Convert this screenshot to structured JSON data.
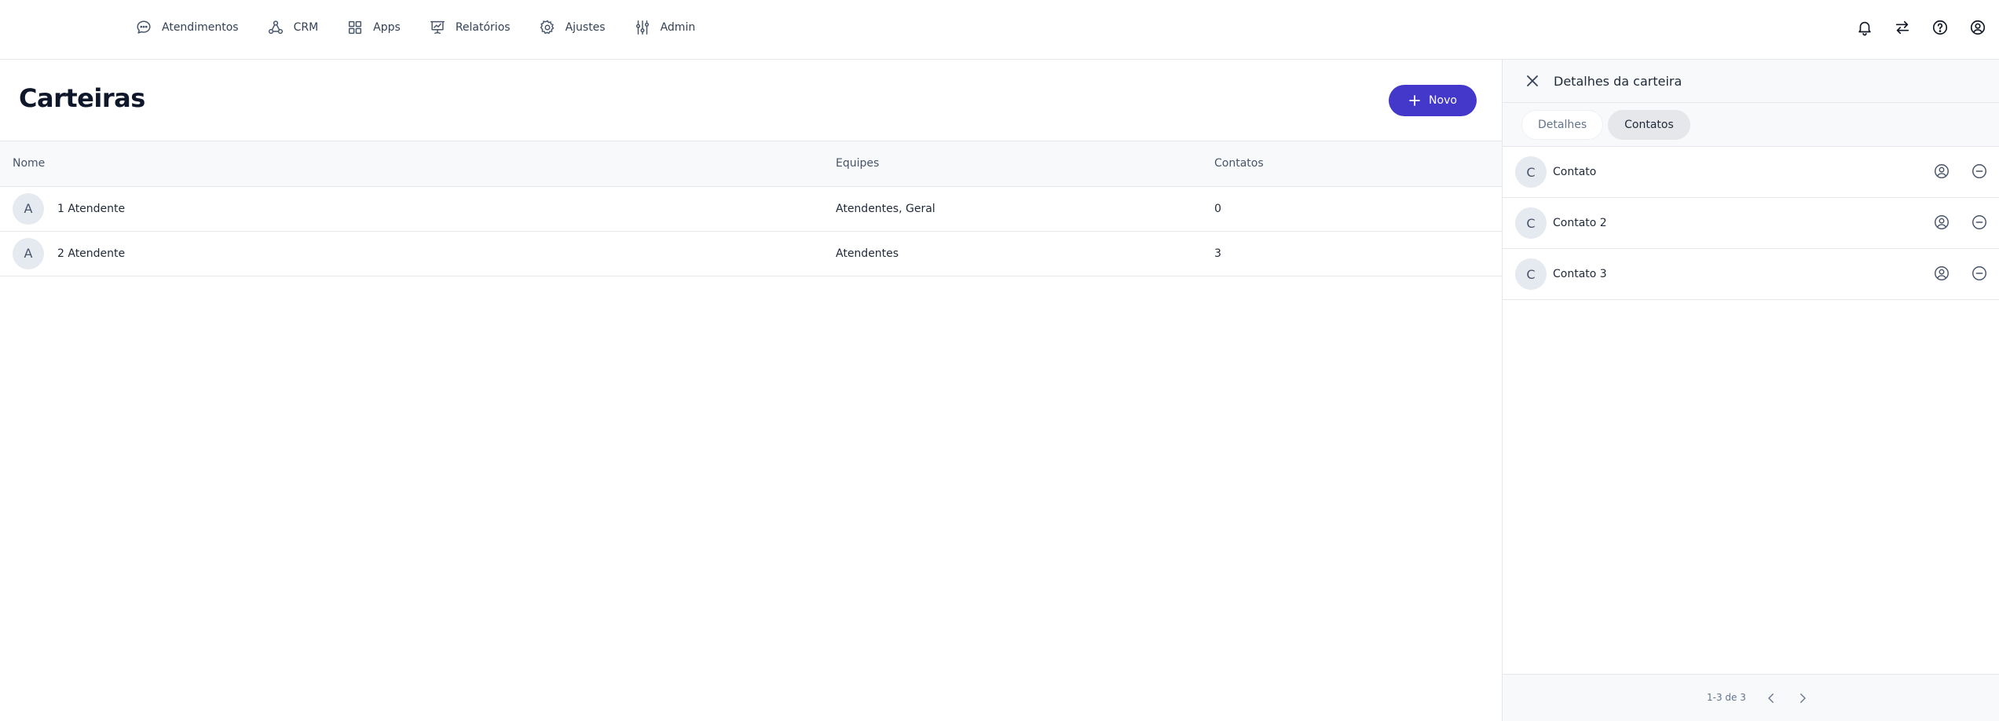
{
  "nav": {
    "items": [
      {
        "label": "Atendimentos",
        "icon": "chat-bubble-icon"
      },
      {
        "label": "CRM",
        "icon": "network-icon"
      },
      {
        "label": "Apps",
        "icon": "grid-icon"
      },
      {
        "label": "Relatórios",
        "icon": "presentation-chart-icon"
      },
      {
        "label": "Ajustes",
        "icon": "gear-icon"
      },
      {
        "label": "Admin",
        "icon": "sliders-icon"
      }
    ],
    "actions": [
      "bell-icon",
      "switch-arrows-icon",
      "help-icon",
      "user-circle-icon"
    ]
  },
  "page": {
    "title": "Carteiras",
    "new_button": "Novo"
  },
  "table": {
    "headers": [
      "Nome",
      "Equipes",
      "Contatos"
    ],
    "rows": [
      {
        "initial": "A",
        "name": "1 Atendente",
        "teams": "Atendentes, Geral",
        "contacts": "0"
      },
      {
        "initial": "A",
        "name": "2 Atendente",
        "teams": "Atendentes",
        "contacts": "3"
      }
    ]
  },
  "panel": {
    "title": "Detalhes da carteira",
    "tabs": [
      {
        "label": "Detalhes",
        "active": false
      },
      {
        "label": "Contatos",
        "active": true
      }
    ],
    "contacts": [
      {
        "initial": "C",
        "name": "Contato"
      },
      {
        "initial": "C",
        "name": "Contato 2"
      },
      {
        "initial": "C",
        "name": "Contato 3"
      }
    ],
    "pagination": "1-3 de 3"
  },
  "colors": {
    "accent": "#4338ca",
    "border": "#e5e7eb",
    "header_bg": "#f8f9fb"
  }
}
